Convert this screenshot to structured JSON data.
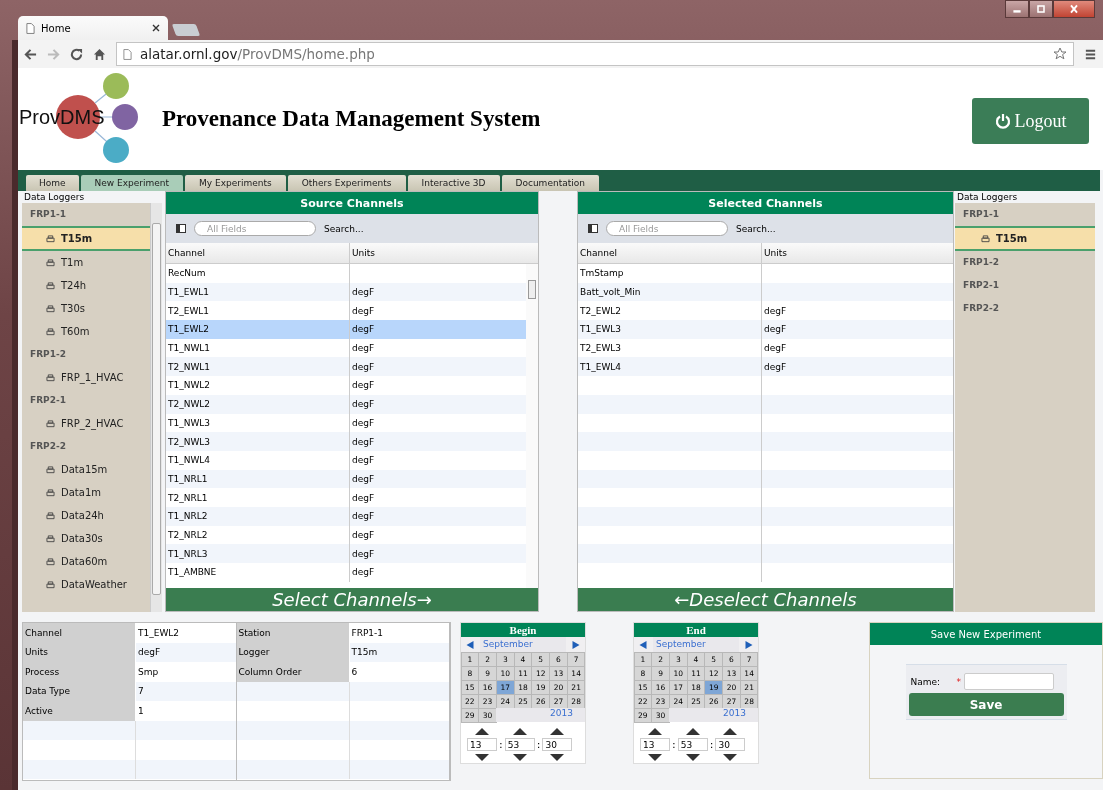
{
  "browser": {
    "tab_title": "Home",
    "url_host": "alatar.ornl.gov",
    "url_path": "/ProvDMS/home.php"
  },
  "header": {
    "logo_text": "ProvDMS",
    "title": "Provenance Data Management System",
    "logout": "Logout"
  },
  "nav_tabs": [
    {
      "label": "Home",
      "selected": false
    },
    {
      "label": "New Experiment",
      "selected": true
    },
    {
      "label": "My Experiments",
      "selected": false
    },
    {
      "label": "Others Experiments",
      "selected": false
    },
    {
      "label": "Interactive 3D",
      "selected": false
    },
    {
      "label": "Documentation",
      "selected": false
    }
  ],
  "left_tree": {
    "title": "Data Loggers",
    "groups": [
      {
        "label": "FRP1-1",
        "children": [
          {
            "label": "T15m",
            "selected": true
          },
          {
            "label": "T1m",
            "selected": false
          },
          {
            "label": "T24h",
            "selected": false
          },
          {
            "label": "T30s",
            "selected": false
          },
          {
            "label": "T60m",
            "selected": false
          }
        ]
      },
      {
        "label": "FRP1-2",
        "children": [
          {
            "label": "FRP_1_HVAC",
            "selected": false
          }
        ]
      },
      {
        "label": "FRP2-1",
        "children": [
          {
            "label": "FRP_2_HVAC",
            "selected": false
          }
        ]
      },
      {
        "label": "FRP2-2",
        "children": [
          {
            "label": "Data15m",
            "selected": false
          },
          {
            "label": "Data1m",
            "selected": false
          },
          {
            "label": "Data24h",
            "selected": false
          },
          {
            "label": "Data30s",
            "selected": false
          },
          {
            "label": "Data60m",
            "selected": false
          },
          {
            "label": "DataWeather",
            "selected": false
          }
        ]
      }
    ]
  },
  "source": {
    "title": "Source Channels",
    "search_placeholder": "All Fields",
    "search_label": "Search...",
    "columns": [
      "Channel",
      "Units"
    ],
    "action": "Select Channels→",
    "rows": [
      {
        "channel": "RecNum",
        "selected": false
      },
      {
        "channel": "T1_EWL1",
        "units": "degF",
        "selected": false
      },
      {
        "channel": "T2_EWL1",
        "units": "degF",
        "selected": false
      },
      {
        "channel": "T1_EWL2",
        "units": "degF",
        "selected": true
      },
      {
        "channel": "T1_NWL1",
        "units": "degF",
        "selected": false
      },
      {
        "channel": "T2_NWL1",
        "units": "degF",
        "selected": false
      },
      {
        "channel": "T1_NWL2",
        "units": "degF",
        "selected": false
      },
      {
        "channel": "T2_NWL2",
        "units": "degF",
        "selected": false
      },
      {
        "channel": "T1_NWL3",
        "units": "degF",
        "selected": false
      },
      {
        "channel": "T2_NWL3",
        "units": "degF",
        "selected": false
      },
      {
        "channel": "T1_NWL4",
        "units": "degF",
        "selected": false
      },
      {
        "channel": "T1_NRL1",
        "units": "degF",
        "selected": false
      },
      {
        "channel": "T2_NRL1",
        "units": "degF",
        "selected": false
      },
      {
        "channel": "T1_NRL2",
        "units": "degF",
        "selected": false
      },
      {
        "channel": "T2_NRL2",
        "units": "degF",
        "selected": false
      },
      {
        "channel": "T1_NRL3",
        "units": "degF",
        "selected": false
      },
      {
        "channel": "T1_AMBNE",
        "units": "degF",
        "selected": false
      }
    ]
  },
  "selected_channels": {
    "title": "Selected Channels",
    "search_placeholder": "All Fields",
    "search_label": "Search...",
    "columns": [
      "Channel",
      "Units"
    ],
    "action": "←Deselect Channels",
    "rows": [
      {
        "channel": "TmStamp",
        "selected": false
      },
      {
        "channel": "Batt_volt_Min",
        "selected": false
      },
      {
        "channel": "T2_EWL2",
        "units": "degF",
        "selected": false
      },
      {
        "channel": "T1_EWL3",
        "units": "degF",
        "selected": false
      },
      {
        "channel": "T2_EWL3",
        "units": "degF",
        "selected": false
      },
      {
        "channel": "T1_EWL4",
        "units": "degF",
        "selected": false
      }
    ]
  },
  "right_tree": {
    "title": "Data Loggers",
    "groups": [
      {
        "label": "FRP1-1",
        "children": [
          {
            "label": "T15m",
            "selected": true
          }
        ]
      },
      {
        "label": "FRP1-2"
      },
      {
        "label": "FRP2-1"
      },
      {
        "label": "FRP2-2"
      }
    ]
  },
  "details": {
    "left": [
      {
        "label": "Channel",
        "value": "T1_EWL2"
      },
      {
        "label": "Units",
        "value": "degF"
      },
      {
        "label": "Process",
        "value": "Smp"
      },
      {
        "label": "Data Type",
        "value": "7"
      },
      {
        "label": "Active",
        "value": "1"
      }
    ],
    "right": [
      {
        "label": "Station",
        "value": "FRP1-1"
      },
      {
        "label": "Logger",
        "value": "T15m"
      },
      {
        "label": "Column Order",
        "value": "6"
      }
    ]
  },
  "calendars": [
    {
      "title": "Begin",
      "month": "September",
      "year": "2013",
      "time": [
        "13",
        "53",
        "30"
      ],
      "time_separator": ":",
      "days": [
        {
          "d": "1",
          "selected": false
        },
        {
          "d": "2",
          "selected": false
        },
        {
          "d": "3",
          "selected": false
        },
        {
          "d": "4",
          "selected": false
        },
        {
          "d": "5",
          "selected": false
        },
        {
          "d": "6",
          "selected": false
        },
        {
          "d": "7",
          "selected": false
        },
        {
          "d": "8",
          "selected": false
        },
        {
          "d": "9",
          "selected": false
        },
        {
          "d": "10",
          "selected": false
        },
        {
          "d": "11",
          "selected": false
        },
        {
          "d": "12",
          "selected": false
        },
        {
          "d": "13",
          "selected": false
        },
        {
          "d": "14",
          "selected": false
        },
        {
          "d": "15",
          "selected": false
        },
        {
          "d": "16",
          "selected": false
        },
        {
          "d": "17",
          "selected": true
        },
        {
          "d": "18",
          "selected": false
        },
        {
          "d": "19",
          "selected": false
        },
        {
          "d": "20",
          "selected": false
        },
        {
          "d": "21",
          "selected": false
        },
        {
          "d": "22",
          "selected": false
        },
        {
          "d": "23",
          "selected": false
        },
        {
          "d": "24",
          "selected": false
        },
        {
          "d": "25",
          "selected": false
        },
        {
          "d": "26",
          "selected": false
        },
        {
          "d": "27",
          "selected": false
        },
        {
          "d": "28",
          "selected": false
        },
        {
          "d": "29",
          "selected": false
        },
        {
          "d": "30",
          "selected": false
        }
      ]
    },
    {
      "title": "End",
      "month": "September",
      "year": "2013",
      "time": [
        "13",
        "53",
        "30"
      ],
      "time_separator": ":",
      "days": [
        {
          "d": "1",
          "selected": false
        },
        {
          "d": "2",
          "selected": false
        },
        {
          "d": "3",
          "selected": false
        },
        {
          "d": "4",
          "selected": false
        },
        {
          "d": "5",
          "selected": false
        },
        {
          "d": "6",
          "selected": false
        },
        {
          "d": "7",
          "selected": false
        },
        {
          "d": "8",
          "selected": false
        },
        {
          "d": "9",
          "selected": false
        },
        {
          "d": "10",
          "selected": false
        },
        {
          "d": "11",
          "selected": false
        },
        {
          "d": "12",
          "selected": false
        },
        {
          "d": "13",
          "selected": false
        },
        {
          "d": "14",
          "selected": false
        },
        {
          "d": "15",
          "selected": false
        },
        {
          "d": "16",
          "selected": false
        },
        {
          "d": "17",
          "selected": false
        },
        {
          "d": "18",
          "selected": false
        },
        {
          "d": "19",
          "selected": true
        },
        {
          "d": "20",
          "selected": false
        },
        {
          "d": "21",
          "selected": false
        },
        {
          "d": "22",
          "selected": false
        },
        {
          "d": "23",
          "selected": false
        },
        {
          "d": "24",
          "selected": false
        },
        {
          "d": "25",
          "selected": false
        },
        {
          "d": "26",
          "selected": false
        },
        {
          "d": "27",
          "selected": false
        },
        {
          "d": "28",
          "selected": false
        },
        {
          "d": "29",
          "selected": false
        },
        {
          "d": "30",
          "selected": false
        }
      ]
    }
  ],
  "save_panel": {
    "title": "Save New Experiment",
    "name_label": "Name:",
    "required_mark": "*",
    "button": "Save"
  }
}
